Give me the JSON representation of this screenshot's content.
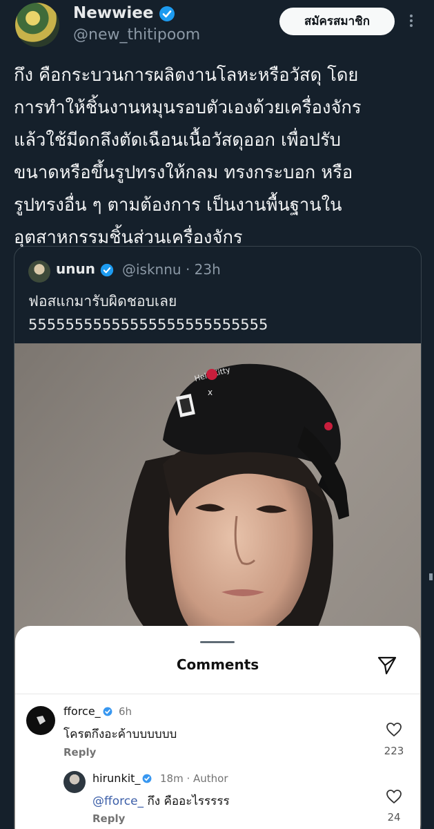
{
  "author": {
    "display_name": "Newwiee",
    "handle": "@new_thitipoom",
    "subscribe_label": "สมัครสมาชิก"
  },
  "tweet": {
    "text": "กึง คือกระบวนการผลิตงานโลหะหรือวัสดุ โดย\nการทำให้ชิ้นงานหมุนรอบตัวเองด้วยเครื่องจักร\nแล้วใช้มีดกลึงตัดเฉือนเนื้อวัสดุออก เพื่อปรับ\nขนาดหรือขึ้นรูปทรงให้กลม ทรงกระบอก หรือ\nรูปทรงอื่น ๆ ตามต้องการ เป็นงานพื้นฐานใน\nอุตสาหกรรมชิ้นส่วนเครื่องจักร"
  },
  "quote": {
    "display_name": "unun",
    "handle": "@isknnu",
    "time": "· 23h",
    "text": "ฟอสแกมารับผิดชอบเลย\n55555555555555555555555555"
  },
  "photo_overlay": {
    "cap_brand": "HelloKitty",
    "cap_x": "x"
  },
  "comments_sheet": {
    "title": "Comments",
    "items": [
      {
        "user": "fforce_",
        "time": "6h",
        "text": "โครตกึงอะค้าบบบบบบ",
        "reply_label": "Reply",
        "likes": "223"
      },
      {
        "user": "hirunkit_",
        "time": "18m · Author",
        "mention": "@fforce_",
        "text": " กึง คืออะไรรรรร",
        "reply_label": "Reply",
        "likes": "24"
      }
    ]
  },
  "colors": {
    "background": "#15202b",
    "verified": "#1d9bf0",
    "muted": "#8b98a5"
  }
}
